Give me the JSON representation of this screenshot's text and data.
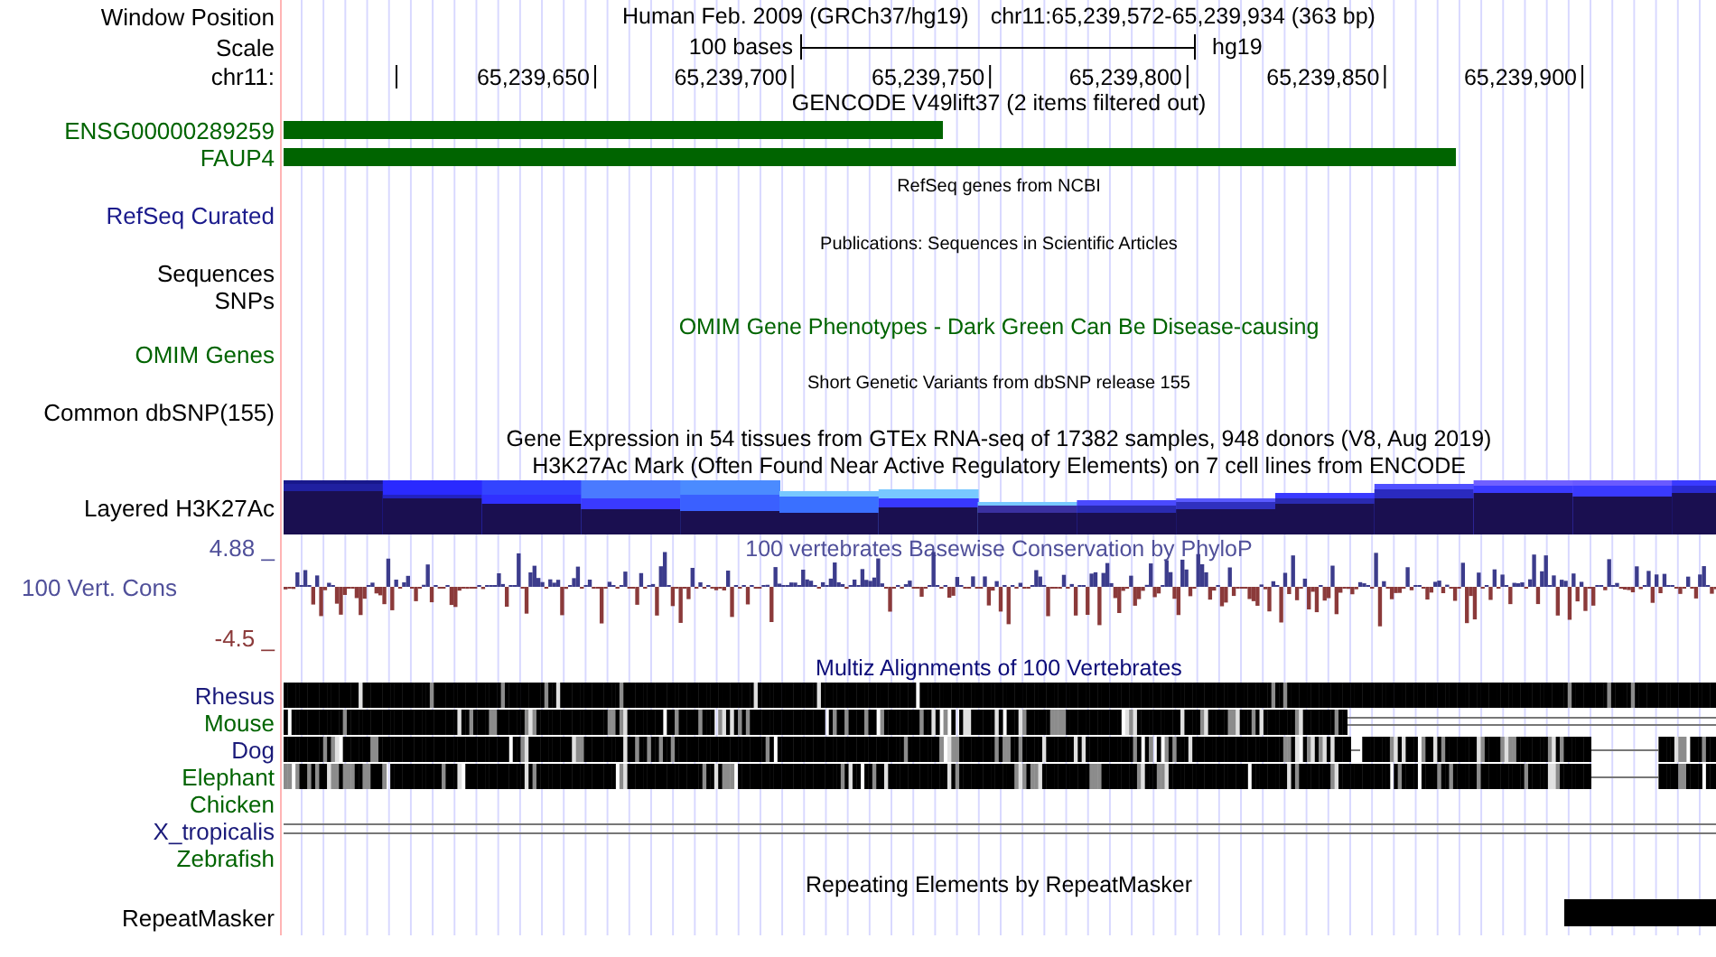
{
  "tracks": [
    {
      "kind": "position",
      "label": "Window Position",
      "assembly": "Human Feb. 2009 (GRCh37/hg19)",
      "position": "chr11:65,239,572-65,239,934 (363 bp)"
    },
    {
      "kind": "scale",
      "label": "Scale",
      "length": "100 bases",
      "assembly": "hg19"
    },
    {
      "kind": "ruler",
      "label": "chr11:",
      "ticks": [
        "65,239,650",
        "65,239,700",
        "65,239,750",
        "65,239,800",
        "65,239,850",
        "65,239,900"
      ]
    },
    {
      "kind": "title",
      "text": "GENCODE V49lift37 (2 items filtered out)",
      "color": "#000000"
    },
    {
      "kind": "gene",
      "label": "ENSG00000289259",
      "color": "#006400"
    },
    {
      "kind": "gene",
      "label": "FAUP4",
      "color": "#006400"
    },
    {
      "kind": "caption",
      "text": "RefSeq genes from NCBI"
    },
    {
      "kind": "label",
      "label": "RefSeq Curated",
      "color": "#1a1a8c"
    },
    {
      "kind": "caption",
      "text": "Publications: Sequences in Scientific Articles"
    },
    {
      "kind": "label",
      "label": "Sequences",
      "color": "#000000"
    },
    {
      "kind": "label",
      "label": "SNPs",
      "color": "#000000"
    },
    {
      "kind": "title",
      "text": "OMIM Gene Phenotypes - Dark Green Can Be Disease-causing",
      "color": "#006400"
    },
    {
      "kind": "label",
      "label": "OMIM Genes",
      "color": "#006400"
    },
    {
      "kind": "caption",
      "text": "Short Genetic Variants from dbSNP release 155"
    },
    {
      "kind": "label",
      "label": "Common dbSNP(155)",
      "color": "#000000"
    },
    {
      "kind": "title",
      "text": "Gene Expression in 54 tissues from GTEx RNA-seq of 17382 samples, 948 donors (V8, Aug 2019)",
      "color": "#000000"
    },
    {
      "kind": "title",
      "text": "H3K27Ac Mark (Often Found Near Active Regulatory Elements) on 7 cell lines from ENCODE",
      "color": "#000000"
    },
    {
      "kind": "layered",
      "label": "Layered H3K27Ac"
    },
    {
      "kind": "wiggle",
      "title": "100 vertebrates Basewise Conservation by PhyloP",
      "max": "4.88 _",
      "label": "100 Vert. Cons",
      "min": "-4.5 _"
    },
    {
      "kind": "title",
      "text": "Multiz Alignments of 100 Vertebrates",
      "color": "#0c0c78"
    },
    {
      "kind": "aligned",
      "label": "Rhesus",
      "color": "#1a1a7a"
    },
    {
      "kind": "aligned",
      "label": "Mouse",
      "color": "#006400"
    },
    {
      "kind": "aligned",
      "label": "Dog",
      "color": "#1a1a7a"
    },
    {
      "kind": "aligned",
      "label": "Elephant",
      "color": "#006400"
    },
    {
      "kind": "unaligned",
      "label": "Chicken",
      "color": "#006400"
    },
    {
      "kind": "bridged",
      "label": "X_tropicalis",
      "color": "#1a1a7a"
    },
    {
      "kind": "unaligned",
      "label": "Zebrafish",
      "color": "#006400"
    },
    {
      "kind": "title",
      "text": "Repeating Elements by RepeatMasker",
      "color": "#000000"
    },
    {
      "kind": "repeat",
      "label": "RepeatMasker"
    }
  ]
}
